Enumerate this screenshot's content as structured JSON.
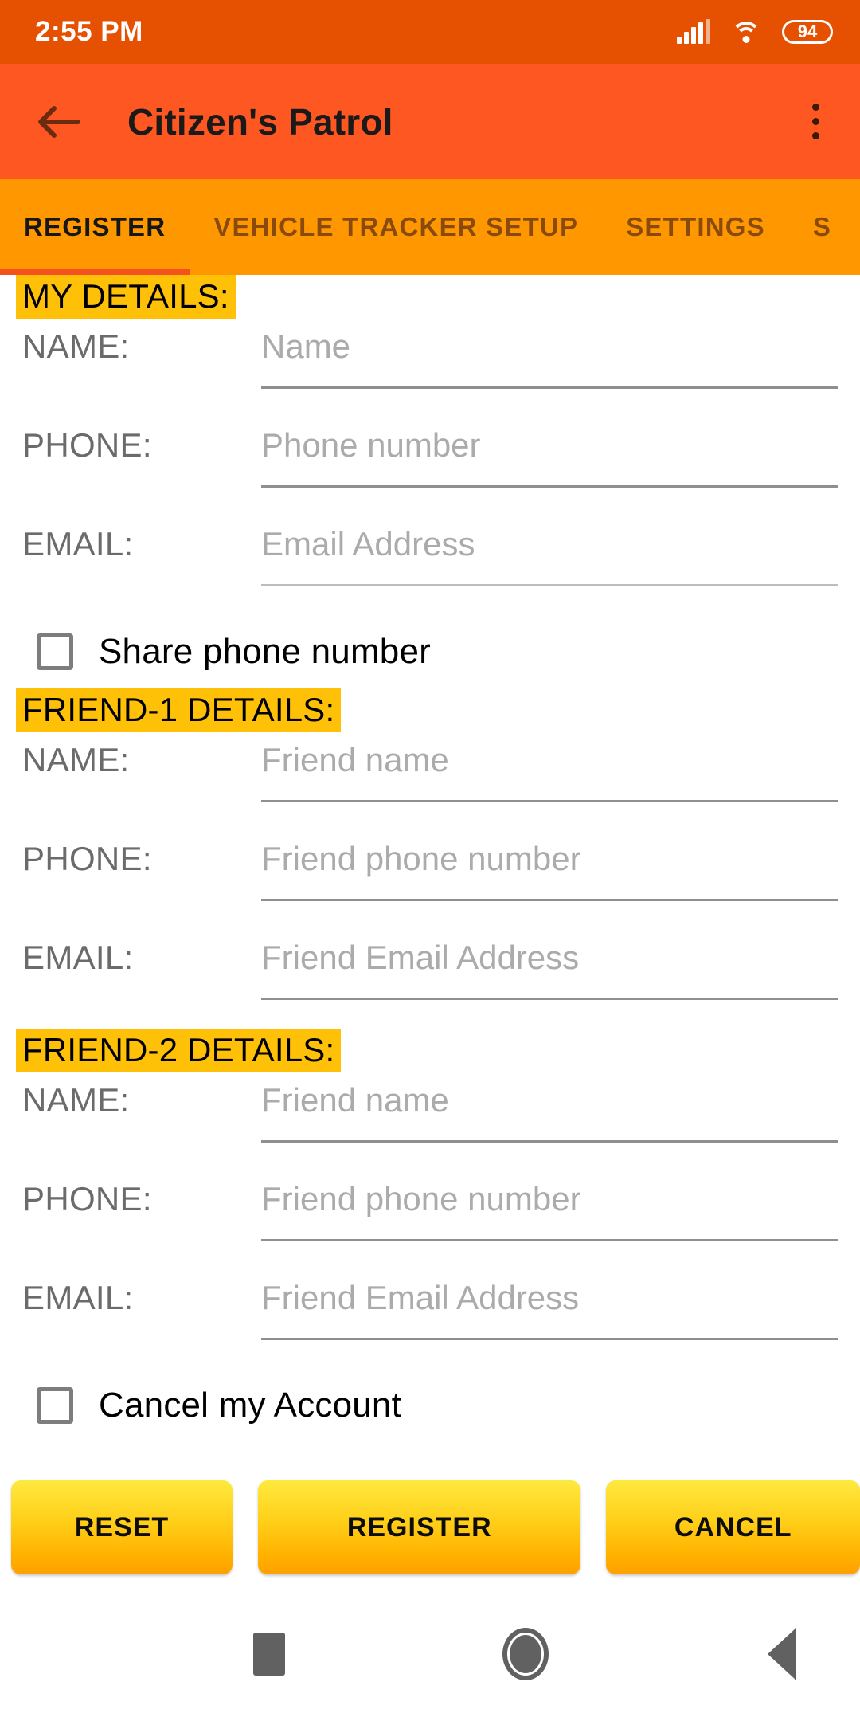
{
  "status_bar": {
    "time": "2:55 PM",
    "battery_level": "94",
    "signal_icon": "signal-bars-icon",
    "wifi_icon": "wifi-icon",
    "battery_icon": "battery-icon",
    "background_color": "#e55100"
  },
  "app_bar": {
    "title": "Citizen's Patrol",
    "back_icon": "back-arrow-icon",
    "overflow_icon": "overflow-menu-icon",
    "background_color": "#ff5722"
  },
  "tabs": {
    "background_color": "#ff9800",
    "indicator_color": "#f4511e",
    "active_index": 0,
    "items": [
      {
        "label": "REGISTER"
      },
      {
        "label": "VEHICLE TRACKER SETUP"
      },
      {
        "label": "SETTINGS"
      },
      {
        "label": "S"
      }
    ]
  },
  "form": {
    "highlight_color": "#ffc107",
    "sections": [
      {
        "heading": "MY DETAILS:",
        "fields": [
          {
            "label": "NAME:",
            "value": "",
            "placeholder": "Name"
          },
          {
            "label": "PHONE:",
            "value": "",
            "placeholder": "Phone number"
          },
          {
            "label": "EMAIL:",
            "value": "",
            "placeholder": "Email Address"
          }
        ],
        "checkbox": {
          "label": "Share phone number",
          "checked": false
        }
      },
      {
        "heading": "FRIEND-1 DETAILS:",
        "fields": [
          {
            "label": "NAME:",
            "value": "",
            "placeholder": "Friend name"
          },
          {
            "label": "PHONE:",
            "value": "",
            "placeholder": "Friend phone number"
          },
          {
            "label": "EMAIL:",
            "value": "",
            "placeholder": "Friend Email Address"
          }
        ]
      },
      {
        "heading": "FRIEND-2 DETAILS:",
        "fields": [
          {
            "label": "NAME:",
            "value": "",
            "placeholder": "Friend name"
          },
          {
            "label": "PHONE:",
            "value": "",
            "placeholder": "Friend phone number"
          },
          {
            "label": "EMAIL:",
            "value": "",
            "placeholder": "Friend Email Address"
          }
        ],
        "checkbox": {
          "label": "Cancel my Account",
          "checked": false
        }
      }
    ]
  },
  "actions": {
    "reset_label": "RESET",
    "register_label": "REGISTER",
    "cancel_label": "CANCEL",
    "gradient_top": "#ffe93f",
    "gradient_bottom": "#ffa000"
  },
  "nav_bar": {
    "recents_icon": "square-recents-icon",
    "home_icon": "circle-home-icon",
    "back_icon": "triangle-back-icon"
  }
}
